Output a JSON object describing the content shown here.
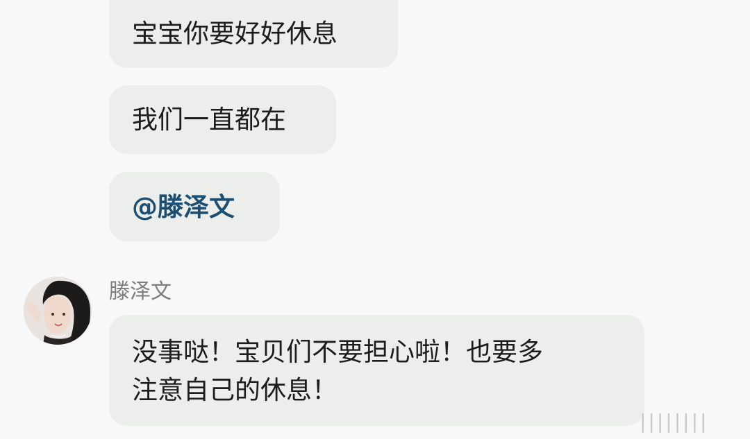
{
  "messages": [
    {
      "text": "宝宝你要好好休息"
    },
    {
      "text": "我们一直都在"
    },
    {
      "text": "@滕泽文"
    }
  ],
  "reply": {
    "sender_name": "滕泽文",
    "lines": [
      "没事哒！宝贝们不要担心啦！也要多",
      "注意自己的休息！"
    ]
  },
  "watermark": {
    "text": "||||||||"
  },
  "colors": {
    "bubble": "#eceeec",
    "mention": "#1d4f73",
    "background": "#f8f8f9",
    "sender": "#7d7d7d"
  }
}
